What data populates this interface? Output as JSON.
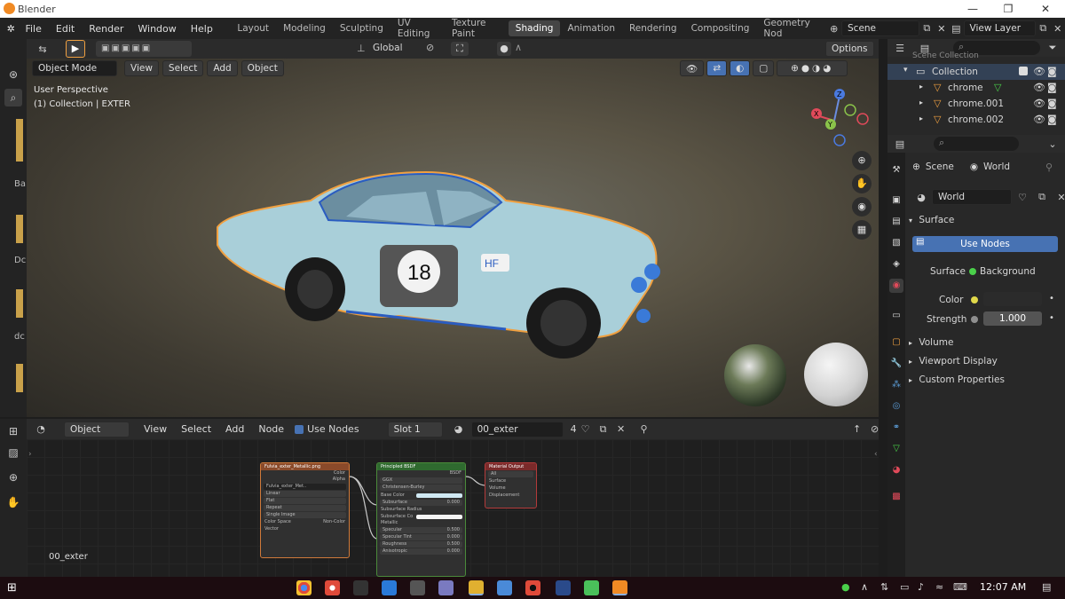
{
  "window": {
    "title": "Blender"
  },
  "menubar": {
    "menus": [
      "File",
      "Edit",
      "Render",
      "Window",
      "Help"
    ],
    "workspace_tabs": [
      "Layout",
      "Modeling",
      "Sculpting",
      "UV Editing",
      "Texture Paint",
      "Shading",
      "Animation",
      "Rendering",
      "Compositing",
      "Geometry Nod"
    ],
    "active_tab": "Shading",
    "scene": "Scene",
    "view_layer": "View Layer"
  },
  "viewport": {
    "mode": "Object Mode",
    "menus": [
      "View",
      "Select",
      "Add",
      "Object"
    ],
    "transform": "Global",
    "options": "Options",
    "overlay_line1": "User Perspective",
    "overlay_line2": "(1) Collection | EXTER",
    "car_number": "18",
    "car_badge": "HF"
  },
  "node_editor": {
    "editor_type": "Object",
    "menus": [
      "View",
      "Select",
      "Add",
      "Node"
    ],
    "use_nodes": "Use Nodes",
    "slot": "Slot 1",
    "material": "00_exter",
    "users": "4",
    "footer_label": "00_exter",
    "image_node": {
      "title": "Fulvia_exter_Metallic.png",
      "outputs": [
        "Color",
        "Alpha"
      ],
      "image": "Fulvia_exter_Met..",
      "fields": [
        "Linear",
        "Flat",
        "Repeat",
        "Single Image"
      ],
      "color_space_label": "Color Space",
      "color_space": "Non-Color",
      "input": "Vector"
    },
    "bsdf_node": {
      "title": "Principled BSDF",
      "output": "BSDF",
      "fields": [
        "GGX",
        "Christensen-Burley"
      ],
      "inputs": [
        {
          "label": "Base Color",
          "value": ""
        },
        {
          "label": "Subsurface",
          "value": "0.000"
        },
        {
          "label": "Subsurface Radius",
          "value": ""
        },
        {
          "label": "Subsurface Co",
          "value": ""
        },
        {
          "label": "Metallic",
          "value": ""
        },
        {
          "label": "Specular",
          "value": "0.500"
        },
        {
          "label": "Specular Tint",
          "value": "0.000"
        },
        {
          "label": "Roughness",
          "value": "0.500"
        },
        {
          "label": "Anisotropic",
          "value": "0.000"
        }
      ]
    },
    "output_node": {
      "title": "Material Output",
      "target": "All",
      "inputs": [
        "Surface",
        "Volume",
        "Displacement"
      ]
    }
  },
  "outliner": {
    "top_item": "Scene Collection",
    "collection": "Collection",
    "items": [
      "chrome",
      "chrome.001",
      "chrome.002"
    ]
  },
  "properties": {
    "breadcrumb_scene": "Scene",
    "breadcrumb_world": "World",
    "world_name": "World",
    "surface_panel": "Surface",
    "use_nodes": "Use Nodes",
    "surface_label": "Surface",
    "surface_value": "Background",
    "color_label": "Color",
    "strength_label": "Strength",
    "strength_value": "1.000",
    "panels": [
      "Volume",
      "Viewport Display",
      "Custom Properties"
    ]
  },
  "left_strip": {
    "labels": [
      "Ba",
      "Dc",
      "dc"
    ]
  },
  "taskbar": {
    "time": "12:07 AM"
  },
  "colors": {
    "accent_blue": "#4772b3",
    "selection_orange": "#f0a040",
    "car_body": "#a9cfd9",
    "taskbar": "#1c0c10"
  }
}
